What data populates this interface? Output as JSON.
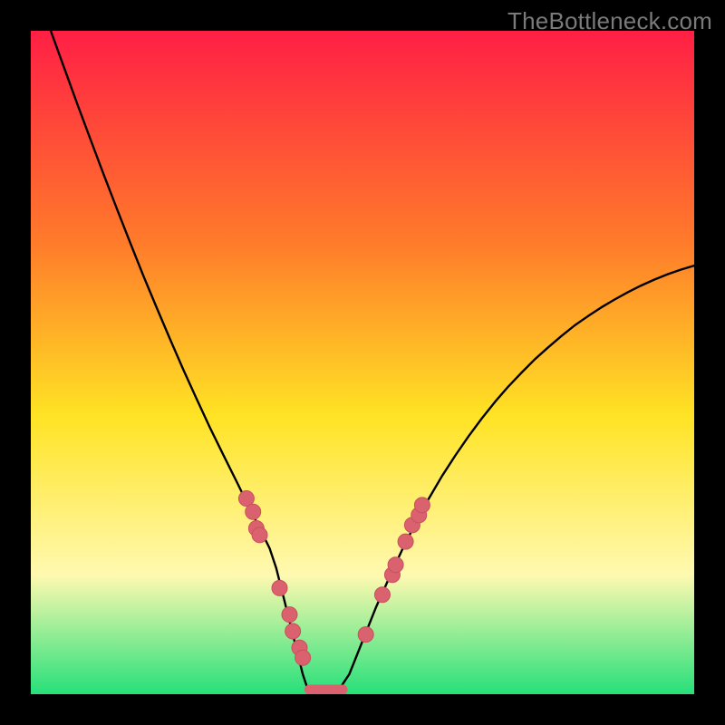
{
  "watermark_text": "TheBottleneck.com",
  "colors": {
    "frame": "#000000",
    "gradient_top": "#ff1f45",
    "gradient_mid_upper": "#ff7b2a",
    "gradient_mid": "#ffe324",
    "gradient_lower": "#fff9b0",
    "gradient_bottom": "#26e07a",
    "curve": "#000000",
    "marker_fill": "#d9626e",
    "marker_stroke": "#c9505c",
    "floor_line": "#d9626e"
  },
  "chart_data": {
    "type": "line",
    "title": "",
    "xlabel": "",
    "ylabel": "",
    "xlim": [
      0,
      100
    ],
    "ylim": [
      0,
      100
    ],
    "grid": false,
    "legend": false,
    "series": [
      {
        "name": "bottleneck-curve",
        "x": [
          3,
          5,
          7,
          9,
          11,
          13,
          15,
          17,
          19,
          21,
          23,
          25,
          27,
          29,
          31,
          33,
          35,
          36,
          37,
          38,
          39,
          40,
          41,
          42,
          43,
          44,
          45,
          46,
          48,
          50,
          52,
          54,
          56,
          58,
          60,
          62,
          64,
          66,
          68,
          70,
          72,
          74,
          76,
          78,
          80,
          82,
          84,
          86,
          88,
          90,
          92,
          94,
          96,
          98,
          100
        ],
        "y": [
          100,
          94.5,
          89,
          83.6,
          78.3,
          73.1,
          68,
          63,
          58.2,
          53.5,
          48.9,
          44.5,
          40.2,
          36.1,
          32.1,
          28,
          24,
          22,
          19,
          15,
          11,
          7,
          3,
          0,
          0,
          0,
          0,
          0,
          3,
          8,
          13,
          17.5,
          21.8,
          25.8,
          29.5,
          32.9,
          36,
          38.9,
          41.6,
          44.1,
          46.4,
          48.5,
          50.5,
          52.3,
          54,
          55.6,
          57,
          58.3,
          59.5,
          60.6,
          61.6,
          62.5,
          63.3,
          64,
          64.6
        ]
      }
    ],
    "markers": {
      "name": "data-points",
      "points": [
        {
          "x": 32.5,
          "y": 29.5
        },
        {
          "x": 33.5,
          "y": 27.5
        },
        {
          "x": 34.0,
          "y": 25.0
        },
        {
          "x": 34.5,
          "y": 24.0
        },
        {
          "x": 37.5,
          "y": 16.0
        },
        {
          "x": 39.0,
          "y": 12.0
        },
        {
          "x": 39.5,
          "y": 9.5
        },
        {
          "x": 40.5,
          "y": 7.0
        },
        {
          "x": 41.0,
          "y": 5.5
        },
        {
          "x": 50.5,
          "y": 9.0
        },
        {
          "x": 53.0,
          "y": 15.0
        },
        {
          "x": 54.5,
          "y": 18.0
        },
        {
          "x": 55.0,
          "y": 19.5
        },
        {
          "x": 56.5,
          "y": 23.0
        },
        {
          "x": 57.5,
          "y": 25.5
        },
        {
          "x": 58.5,
          "y": 27.0
        },
        {
          "x": 59.0,
          "y": 28.5
        }
      ]
    },
    "floor_segment": {
      "x0": 42,
      "x1": 47,
      "y": 0
    }
  }
}
